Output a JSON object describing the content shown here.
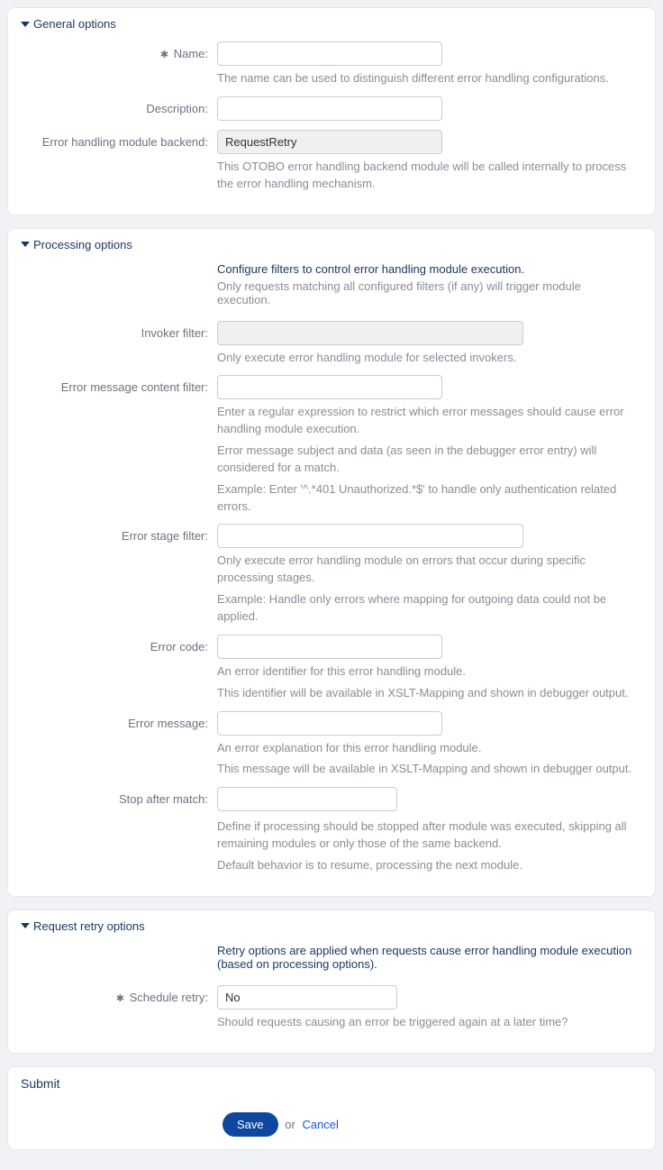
{
  "sections": {
    "general": {
      "title": "General options",
      "name_label": "Name:",
      "name_help": "The name can be used to distinguish different error handling configurations.",
      "description_label": "Description:",
      "backend_label": "Error handling module backend:",
      "backend_value": "RequestRetry",
      "backend_help": "This OTOBO error handling backend module will be called internally to process the error handling mechanism."
    },
    "processing": {
      "title": "Processing options",
      "intro": "Configure filters to control error handling module execution.",
      "intro_sub": "Only requests matching all configured filters (if any) will trigger module execution.",
      "invoker_label": "Invoker filter:",
      "invoker_help": "Only execute error handling module for selected invokers.",
      "content_label": "Error message content filter:",
      "content_help1": "Enter a regular expression to restrict which error messages should cause error handling module execution.",
      "content_help2": "Error message subject and data (as seen in the debugger error entry) will considered for a match.",
      "content_help3": "Example: Enter '^.*401 Unauthorized.*$' to handle only authentication related errors.",
      "stage_label": "Error stage filter:",
      "stage_help1": "Only execute error handling module on errors that occur during specific processing stages.",
      "stage_help2": "Example: Handle only errors where mapping for outgoing data could not be applied.",
      "code_label": "Error code:",
      "code_help1": "An error identifier for this error handling module.",
      "code_help2": "This identifier will be available in XSLT-Mapping and shown in debugger output.",
      "message_label": "Error message:",
      "message_help1": "An error explanation for this error handling module.",
      "message_help2": "This message will be available in XSLT-Mapping and shown in debugger output.",
      "stop_label": "Stop after match:",
      "stop_help1": "Define if processing should be stopped after module was executed, skipping all remaining modules or only those of the same backend.",
      "stop_help2": "Default behavior is to resume, processing the next module."
    },
    "retry": {
      "title": "Request retry options",
      "intro": "Retry options are applied when requests cause error handling module execution (based on processing options).",
      "schedule_label": "Schedule retry:",
      "schedule_value": "No",
      "schedule_help": "Should requests causing an error be triggered again at a later time?"
    },
    "submit": {
      "title": "Submit",
      "save": "Save",
      "or": "or",
      "cancel": "Cancel"
    }
  }
}
